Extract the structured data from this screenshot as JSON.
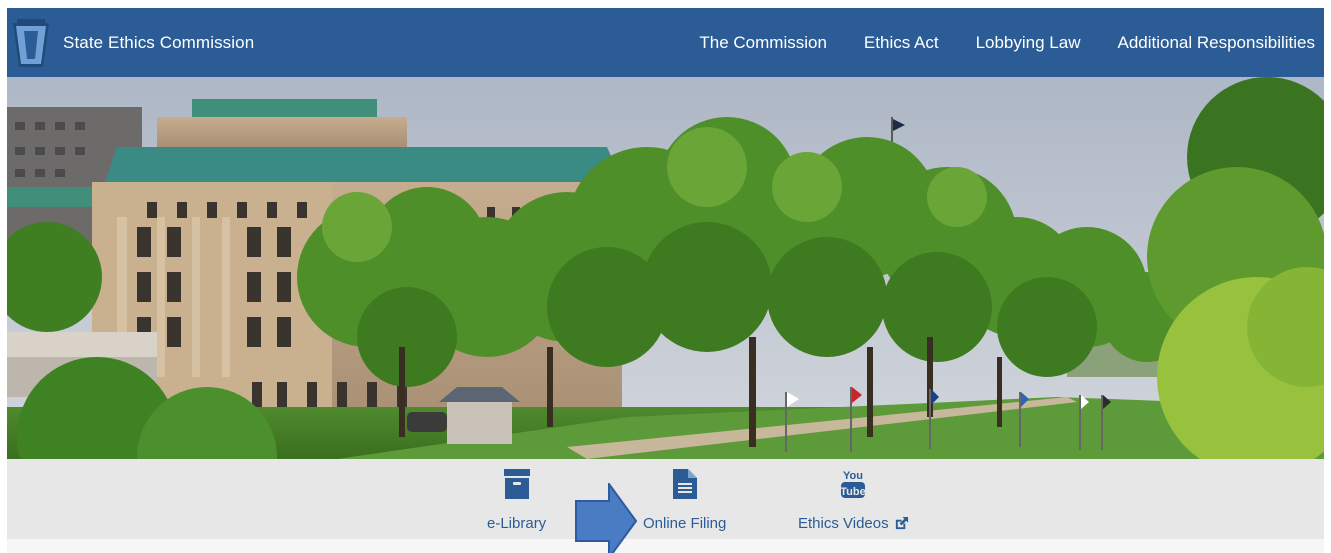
{
  "header": {
    "site_title": "State Ethics Commission",
    "logo_icon": "keystone-logo-icon",
    "nav": [
      {
        "label": "The Commission"
      },
      {
        "label": "Ethics Act"
      },
      {
        "label": "Lobbying Law"
      },
      {
        "label": "Additional Responsibilities"
      }
    ]
  },
  "hero": {
    "image": "capitol-complex-photo"
  },
  "quick_links": [
    {
      "label": "e-Library",
      "icon": "archive-box-icon"
    },
    {
      "label": "Online Filing",
      "icon": "document-icon"
    },
    {
      "label": "Ethics Videos",
      "icon": "youtube-icon",
      "external_icon": "external-link-icon",
      "icon_text_top": "You",
      "icon_text_bottom": "Tube"
    }
  ],
  "annotation": {
    "icon": "arrow-right-icon"
  },
  "colors": {
    "header_bg": "#2b5c95",
    "link": "#2b5c95",
    "quicklinks_bg": "#e7e7e7",
    "arrow": "#4a7cc4"
  }
}
